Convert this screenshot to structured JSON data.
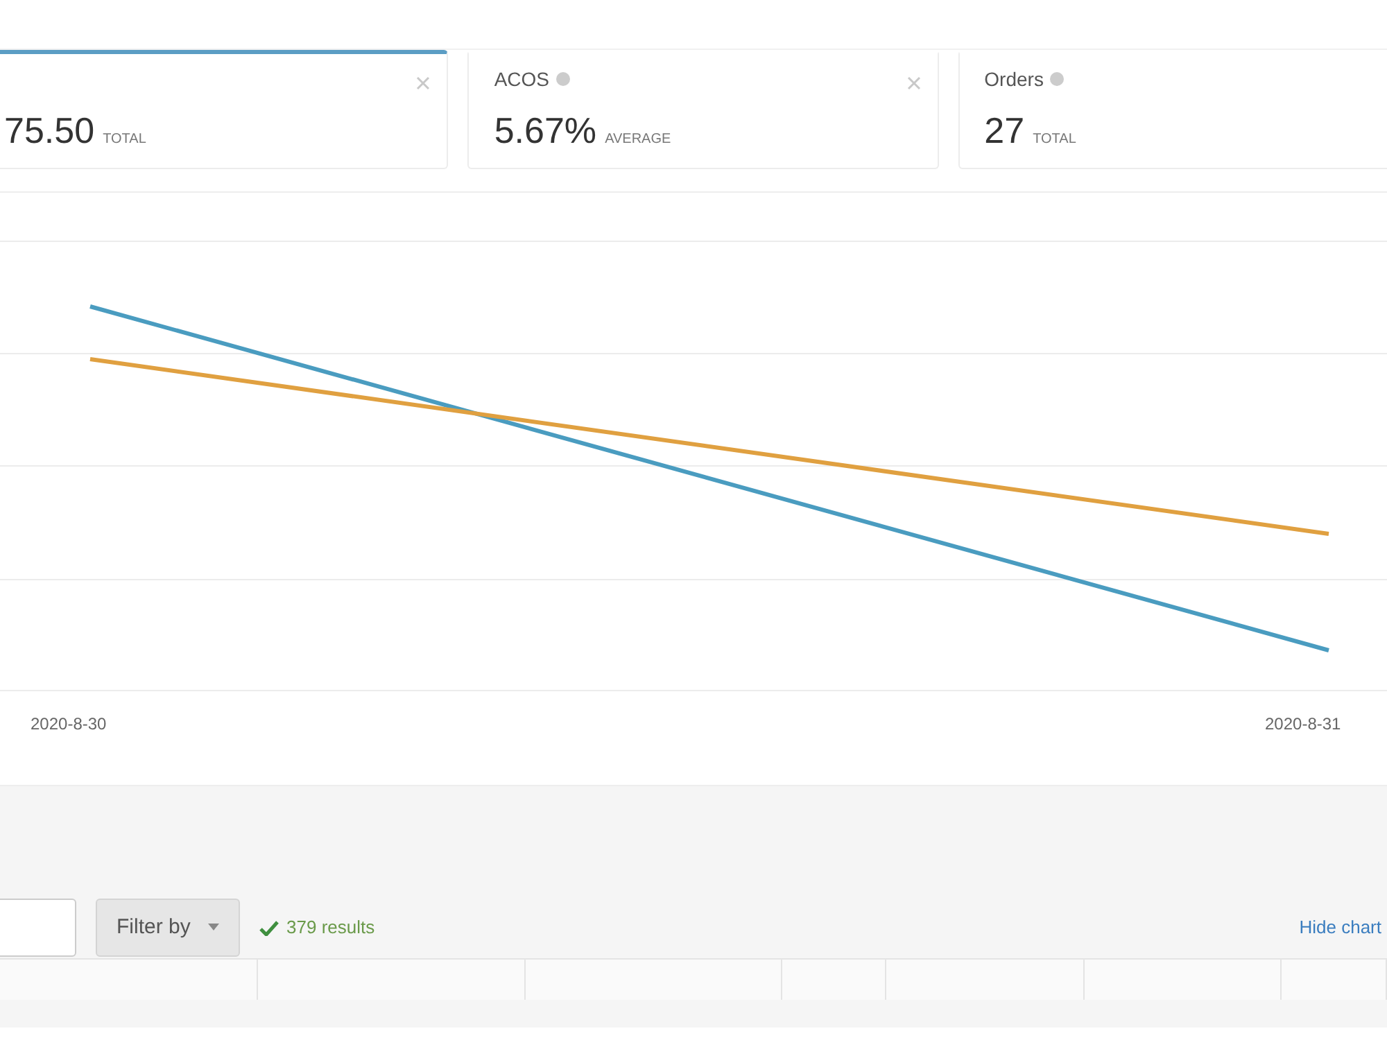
{
  "metric_cards": [
    {
      "info": false,
      "value": "75.50",
      "unit": "TOTAL",
      "selected": true,
      "closable": true
    },
    {
      "title": "ACOS",
      "info": true,
      "value": "5.67%",
      "unit": "AVERAGE",
      "selected": false,
      "closable": true
    },
    {
      "title": "Orders",
      "info": true,
      "value": "27",
      "unit": "TOTAL",
      "selected": false,
      "closable": false
    }
  ],
  "chart": {
    "x_labels": [
      "2020-8-30",
      "2020-8-31"
    ],
    "lines": [
      {
        "color": "#4a9cc0"
      },
      {
        "color": "#e0a040"
      }
    ]
  },
  "toolbar": {
    "filter_button": "Filter by",
    "results": "379 results",
    "hide_link": "Hide chart"
  }
}
